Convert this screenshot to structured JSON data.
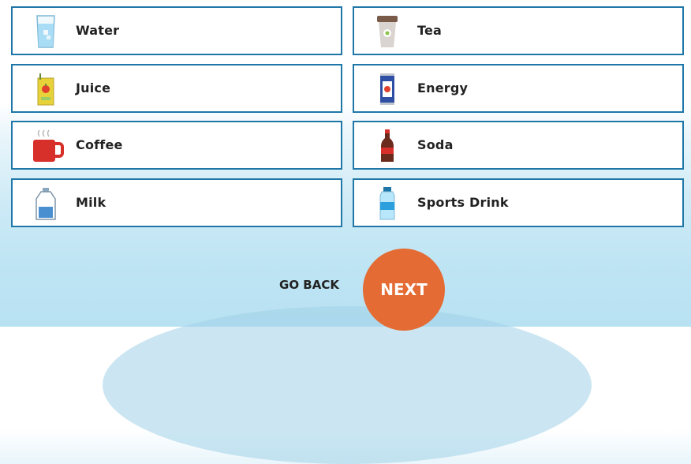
{
  "options": [
    {
      "label": "Water",
      "icon": "water-glass-icon"
    },
    {
      "label": "Tea",
      "icon": "tea-cup-icon"
    },
    {
      "label": "Juice",
      "icon": "juice-box-icon"
    },
    {
      "label": "Energy",
      "icon": "energy-can-icon"
    },
    {
      "label": "Coffee",
      "icon": "coffee-mug-icon"
    },
    {
      "label": "Soda",
      "icon": "soda-bottle-icon"
    },
    {
      "label": "Milk",
      "icon": "milk-jug-icon"
    },
    {
      "label": "Sports Drink",
      "icon": "sports-drink-bottle-icon"
    }
  ],
  "nav": {
    "back_label": "GO BACK",
    "next_label": "NEXT"
  },
  "colors": {
    "border": "#1f77a8",
    "next_button": "#e46b33",
    "background_bottom": "#b8e1f2"
  }
}
